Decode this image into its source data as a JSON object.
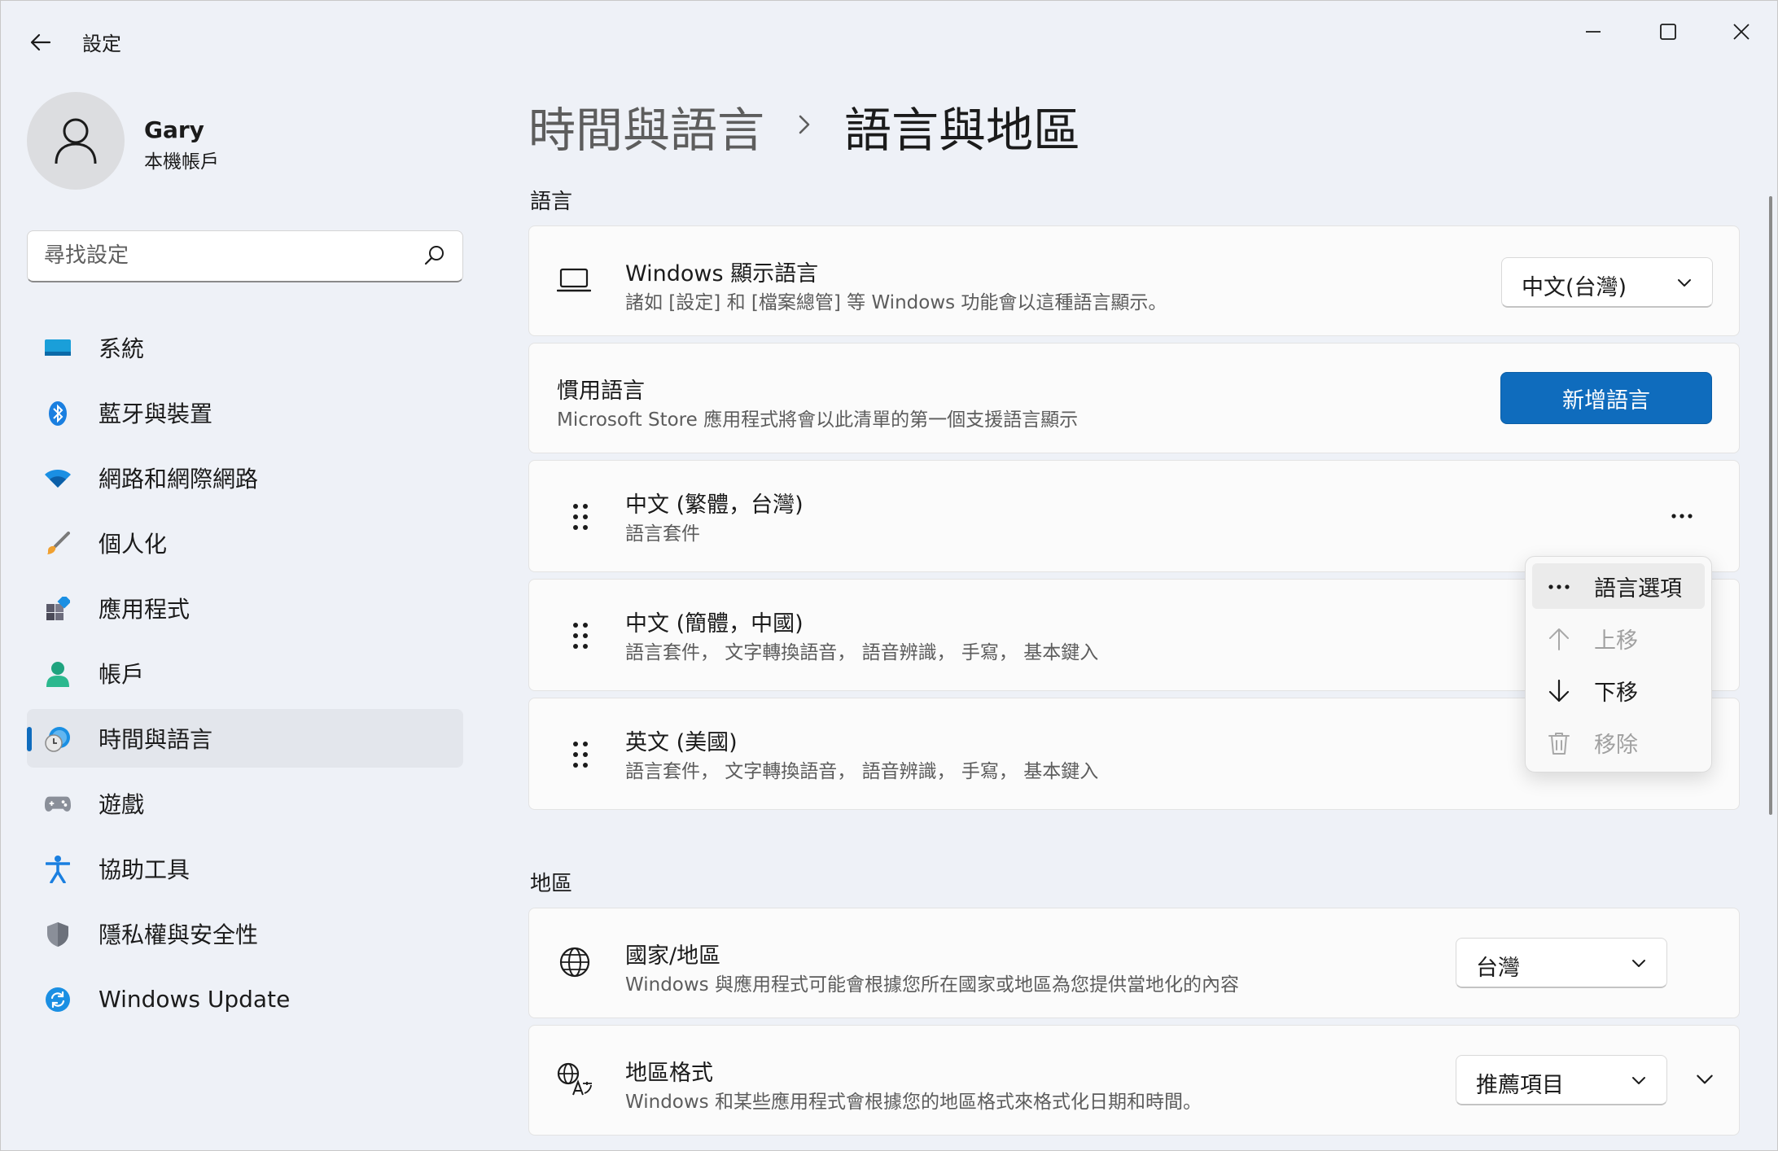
{
  "window": {
    "title": "設定"
  },
  "profile": {
    "name": "Gary",
    "account_type": "本機帳戶"
  },
  "search": {
    "placeholder": "尋找設定"
  },
  "sidebar": {
    "items": [
      {
        "label": "系統",
        "icon": "system-icon"
      },
      {
        "label": "藍牙與裝置",
        "icon": "bluetooth-icon"
      },
      {
        "label": "網路和網際網路",
        "icon": "wifi-icon"
      },
      {
        "label": "個人化",
        "icon": "brush-icon"
      },
      {
        "label": "應用程式",
        "icon": "apps-icon"
      },
      {
        "label": "帳戶",
        "icon": "accounts-icon"
      },
      {
        "label": "時間與語言",
        "icon": "time-language-icon",
        "active": true
      },
      {
        "label": "遊戲",
        "icon": "gaming-icon"
      },
      {
        "label": "協助工具",
        "icon": "accessibility-icon"
      },
      {
        "label": "隱私權與安全性",
        "icon": "shield-icon"
      },
      {
        "label": "Windows Update",
        "icon": "update-icon"
      }
    ]
  },
  "breadcrumb": {
    "parent": "時間與語言",
    "current": "語言與地區"
  },
  "language_section": {
    "title": "語言",
    "display_language": {
      "title": "Windows 顯示語言",
      "description": "諸如 [設定] 和 [檔案總管] 等 Windows 功能會以這種語言顯示。",
      "value": "中文(台灣)"
    },
    "preferred": {
      "title": "慣用語言",
      "description": "Microsoft Store 應用程式將會以此清單的第一個支援語言顯示",
      "add_button": "新增語言"
    },
    "languages": [
      {
        "name": "中文 (繁體，台灣)",
        "features": "語言套件"
      },
      {
        "name": "中文 (簡體，中國)",
        "features": "語言套件， 文字轉換語音， 語音辨識， 手寫， 基本鍵入"
      },
      {
        "name": "英文 (美國)",
        "features": "語言套件， 文字轉換語音， 語音辨識， 手寫， 基本鍵入"
      }
    ],
    "context_menu": {
      "items": [
        {
          "label": "語言選項",
          "icon": "more-icon",
          "disabled": false
        },
        {
          "label": "上移",
          "icon": "arrow-up-icon",
          "disabled": true
        },
        {
          "label": "下移",
          "icon": "arrow-down-icon",
          "disabled": false
        },
        {
          "label": "移除",
          "icon": "trash-icon",
          "disabled": true
        }
      ]
    }
  },
  "region_section": {
    "title": "地區",
    "country": {
      "title": "國家/地區",
      "description": "Windows 與應用程式可能會根據您所在國家或地區為您提供當地化的內容",
      "value": "台灣"
    },
    "format": {
      "title": "地區格式",
      "description": "Windows 和某些應用程式會根據您的地區格式來格式化日期和時間。",
      "value": "推薦項目"
    }
  },
  "colors": {
    "accent": "#0f6cbd",
    "background": "#eef1f7",
    "card": "#fbfbfb"
  }
}
